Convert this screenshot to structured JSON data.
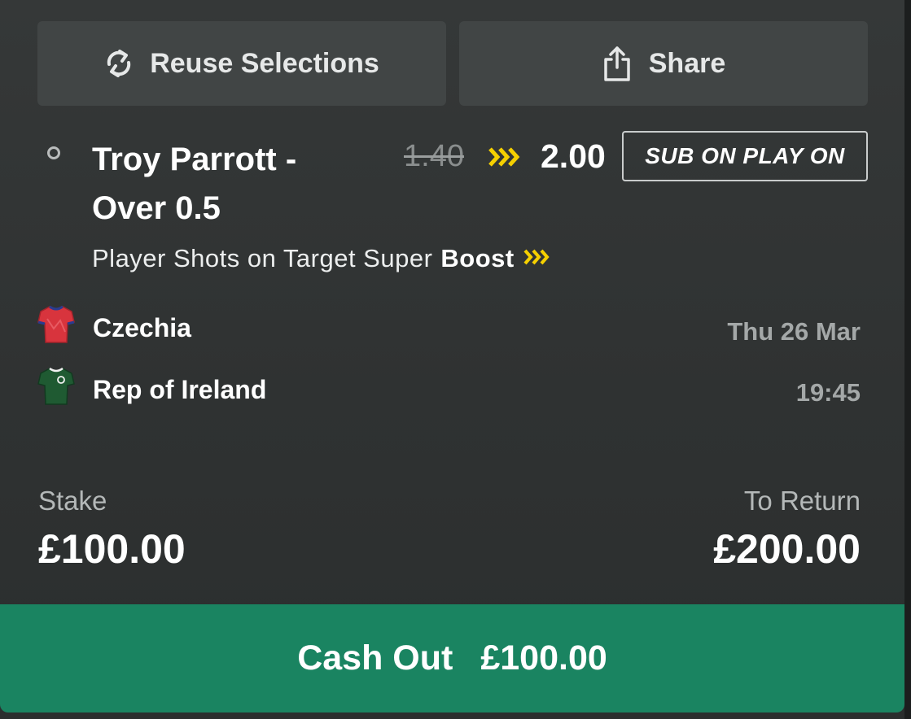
{
  "actions": {
    "reuse_label": "Reuse Selections",
    "share_label": "Share"
  },
  "selection": {
    "title": "Troy Parrott - Over 0.5",
    "old_odds": "1.40",
    "new_odds": "2.00",
    "badge": "SUB ON PLAY ON",
    "market_prefix": "Player Shots on Target Super",
    "market_boost": "Boost"
  },
  "event": {
    "home_team": "Czechia",
    "away_team": "Rep of Ireland",
    "date": "Thu 26 Mar",
    "time": "19:45"
  },
  "bet": {
    "stake_label": "Stake",
    "stake_value": "£100.00",
    "return_label": "To Return",
    "return_value": "£200.00"
  },
  "cashout": {
    "label": "Cash Out",
    "amount": "£100.00"
  },
  "colors": {
    "accent_green": "#1a8461",
    "boost_yellow": "#f5d000",
    "home_shirt": "#d8343d",
    "away_shirt": "#1f5a32"
  },
  "icons": {
    "reuse": "refresh-icon",
    "share": "share-icon",
    "boost": "chevrons-right-icon",
    "home": "shirt-icon",
    "away": "shirt-icon"
  }
}
